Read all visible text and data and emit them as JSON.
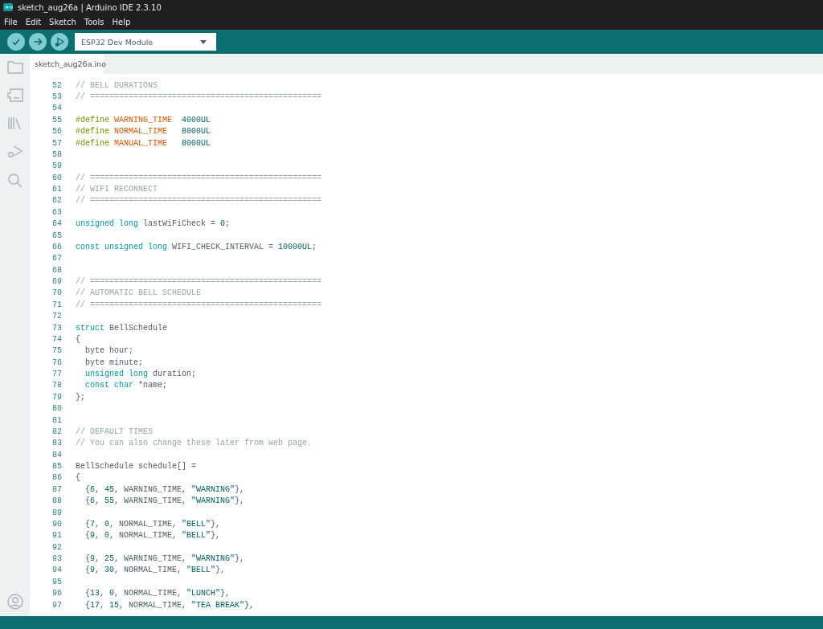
{
  "window": {
    "title": "sketch_aug26a | Arduino IDE 2.3.10"
  },
  "menu": [
    "File",
    "Edit",
    "Sketch",
    "Tools",
    "Help"
  ],
  "toolbar": {
    "board": "ESP32 Dev Module"
  },
  "tabs": [
    {
      "label": "sketch_aug26a.ino",
      "selected": true
    }
  ],
  "editor": {
    "lines": [
      {
        "number": "52",
        "segments": [
          {
            "kind": "comment",
            "text": "// BELL DURATIONS"
          }
        ]
      },
      {
        "number": "53",
        "segments": [
          {
            "kind": "comment",
            "text": "// ================================================"
          }
        ]
      },
      {
        "number": "54"
      },
      {
        "number": "55",
        "segments": [
          {
            "kind": "preprocessor",
            "text": "#define "
          },
          {
            "kind": "macro",
            "text": "WARNING_TIME"
          },
          {
            "kind": "number",
            "text": "  4000UL"
          }
        ]
      },
      {
        "number": "56",
        "segments": [
          {
            "kind": "preprocessor",
            "text": "#define "
          },
          {
            "kind": "macro",
            "text": "NORMAL_TIME"
          },
          {
            "kind": "number",
            "text": "   8000UL"
          }
        ]
      },
      {
        "number": "57",
        "segments": [
          {
            "kind": "preprocessor",
            "text": "#define "
          },
          {
            "kind": "macro",
            "text": "MANUAL_TIME"
          },
          {
            "kind": "number",
            "text": "   8000UL"
          }
        ]
      },
      {
        "number": "58"
      },
      {
        "number": "59"
      },
      {
        "number": "60",
        "segments": [
          {
            "kind": "comment",
            "text": "// ================================================"
          }
        ]
      },
      {
        "number": "61",
        "segments": [
          {
            "kind": "comment",
            "text": "// WIFI RECONNECT"
          }
        ]
      },
      {
        "number": "62",
        "segments": [
          {
            "kind": "comment",
            "text": "// ================================================"
          }
        ]
      },
      {
        "number": "63"
      },
      {
        "number": "64",
        "segments": [
          {
            "kind": "keyword",
            "text": "unsigned long"
          },
          {
            "kind": "plain",
            "text": " lastWiFiCheck = "
          },
          {
            "kind": "number",
            "text": "0"
          },
          {
            "kind": "plain",
            "text": ";"
          }
        ]
      },
      {
        "number": "65"
      },
      {
        "number": "66",
        "segments": [
          {
            "kind": "keyword",
            "text": "const unsigned long"
          },
          {
            "kind": "plain",
            "text": " WIFI_CHECK_INTERVAL = "
          },
          {
            "kind": "number",
            "text": "10000UL"
          },
          {
            "kind": "plain",
            "text": ";"
          }
        ]
      },
      {
        "number": "67"
      },
      {
        "number": "68"
      },
      {
        "number": "69",
        "segments": [
          {
            "kind": "comment",
            "text": "// ================================================"
          }
        ]
      },
      {
        "number": "70",
        "segments": [
          {
            "kind": "comment",
            "text": "// AUTOMATIC BELL SCHEDULE"
          }
        ]
      },
      {
        "number": "71",
        "segments": [
          {
            "kind": "comment",
            "text": "// ================================================"
          }
        ]
      },
      {
        "number": "72"
      },
      {
        "number": "73",
        "segments": [
          {
            "kind": "keyword",
            "text": "struct"
          },
          {
            "kind": "plain",
            "text": " BellSchedule"
          }
        ]
      },
      {
        "number": "74",
        "segments": [
          {
            "kind": "plain",
            "text": "{"
          }
        ]
      },
      {
        "number": "75",
        "segments": [
          {
            "kind": "plain",
            "text": "  byte hour;"
          }
        ]
      },
      {
        "number": "76",
        "segments": [
          {
            "kind": "plain",
            "text": "  byte minute;"
          }
        ]
      },
      {
        "number": "77",
        "segments": [
          {
            "kind": "keyword",
            "text": "  unsigned long"
          },
          {
            "kind": "plain",
            "text": " duration;"
          }
        ]
      },
      {
        "number": "78",
        "segments": [
          {
            "kind": "keyword",
            "text": "  const char"
          },
          {
            "kind": "plain",
            "text": " *name;"
          }
        ]
      },
      {
        "number": "79",
        "segments": [
          {
            "kind": "plain",
            "text": "};"
          }
        ]
      },
      {
        "number": "80"
      },
      {
        "number": "81"
      },
      {
        "number": "82",
        "segments": [
          {
            "kind": "comment",
            "text": "// DEFAULT TIMES"
          }
        ]
      },
      {
        "number": "83",
        "segments": [
          {
            "kind": "comment",
            "text": "// You can also change these later from web page."
          }
        ]
      },
      {
        "number": "84"
      },
      {
        "number": "85",
        "segments": [
          {
            "kind": "plain",
            "text": "BellSchedule schedule[] ="
          }
        ]
      },
      {
        "number": "86",
        "segments": [
          {
            "kind": "plain",
            "text": "{"
          }
        ]
      },
      {
        "number": "87",
        "segments": [
          {
            "kind": "plain",
            "text": "  {"
          },
          {
            "kind": "number",
            "text": "6"
          },
          {
            "kind": "plain",
            "text": ", "
          },
          {
            "kind": "number",
            "text": "45"
          },
          {
            "kind": "plain",
            "text": ", WARNING_TIME, "
          },
          {
            "kind": "string",
            "text": "\"WARNING\""
          },
          {
            "kind": "plain",
            "text": "},"
          }
        ]
      },
      {
        "number": "88",
        "segments": [
          {
            "kind": "plain",
            "text": "  {"
          },
          {
            "kind": "number",
            "text": "6"
          },
          {
            "kind": "plain",
            "text": ", "
          },
          {
            "kind": "number",
            "text": "55"
          },
          {
            "kind": "plain",
            "text": ", WARNING_TIME, "
          },
          {
            "kind": "string",
            "text": "\"WARNING\""
          },
          {
            "kind": "plain",
            "text": "},"
          }
        ]
      },
      {
        "number": "89"
      },
      {
        "number": "90",
        "segments": [
          {
            "kind": "plain",
            "text": "  {"
          },
          {
            "kind": "number",
            "text": "7"
          },
          {
            "kind": "plain",
            "text": ", "
          },
          {
            "kind": "number",
            "text": "0"
          },
          {
            "kind": "plain",
            "text": ", NORMAL_TIME, "
          },
          {
            "kind": "string",
            "text": "\"BELL\""
          },
          {
            "kind": "plain",
            "text": "},"
          }
        ]
      },
      {
        "number": "91",
        "segments": [
          {
            "kind": "plain",
            "text": "  {"
          },
          {
            "kind": "number",
            "text": "9"
          },
          {
            "kind": "plain",
            "text": ", "
          },
          {
            "kind": "number",
            "text": "0"
          },
          {
            "kind": "plain",
            "text": ", NORMAL_TIME, "
          },
          {
            "kind": "string",
            "text": "\"BELL\""
          },
          {
            "kind": "plain",
            "text": "},"
          }
        ]
      },
      {
        "number": "92"
      },
      {
        "number": "93",
        "segments": [
          {
            "kind": "plain",
            "text": "  {"
          },
          {
            "kind": "number",
            "text": "9"
          },
          {
            "kind": "plain",
            "text": ", "
          },
          {
            "kind": "number",
            "text": "25"
          },
          {
            "kind": "plain",
            "text": ", WARNING_TIME, "
          },
          {
            "kind": "string",
            "text": "\"WARNING\""
          },
          {
            "kind": "plain",
            "text": "},"
          }
        ]
      },
      {
        "number": "94",
        "segments": [
          {
            "kind": "plain",
            "text": "  {"
          },
          {
            "kind": "number",
            "text": "9"
          },
          {
            "kind": "plain",
            "text": ", "
          },
          {
            "kind": "number",
            "text": "30"
          },
          {
            "kind": "plain",
            "text": ", NORMAL_TIME, "
          },
          {
            "kind": "string",
            "text": "\"BELL\""
          },
          {
            "kind": "plain",
            "text": "},"
          }
        ]
      },
      {
        "number": "95"
      },
      {
        "number": "96",
        "segments": [
          {
            "kind": "plain",
            "text": "  {"
          },
          {
            "kind": "number",
            "text": "13"
          },
          {
            "kind": "plain",
            "text": ", "
          },
          {
            "kind": "number",
            "text": "0"
          },
          {
            "kind": "plain",
            "text": ", NORMAL_TIME, "
          },
          {
            "kind": "string",
            "text": "\"LUNCH\""
          },
          {
            "kind": "plain",
            "text": "},"
          }
        ]
      },
      {
        "number": "97",
        "segments": [
          {
            "kind": "plain",
            "text": "  {"
          },
          {
            "kind": "number",
            "text": "17"
          },
          {
            "kind": "plain",
            "text": ", "
          },
          {
            "kind": "number",
            "text": "15"
          },
          {
            "kind": "plain",
            "text": ", NORMAL_TIME, "
          },
          {
            "kind": "string",
            "text": "\"TEA BREAK\""
          },
          {
            "kind": "plain",
            "text": "},"
          }
        ]
      }
    ]
  }
}
